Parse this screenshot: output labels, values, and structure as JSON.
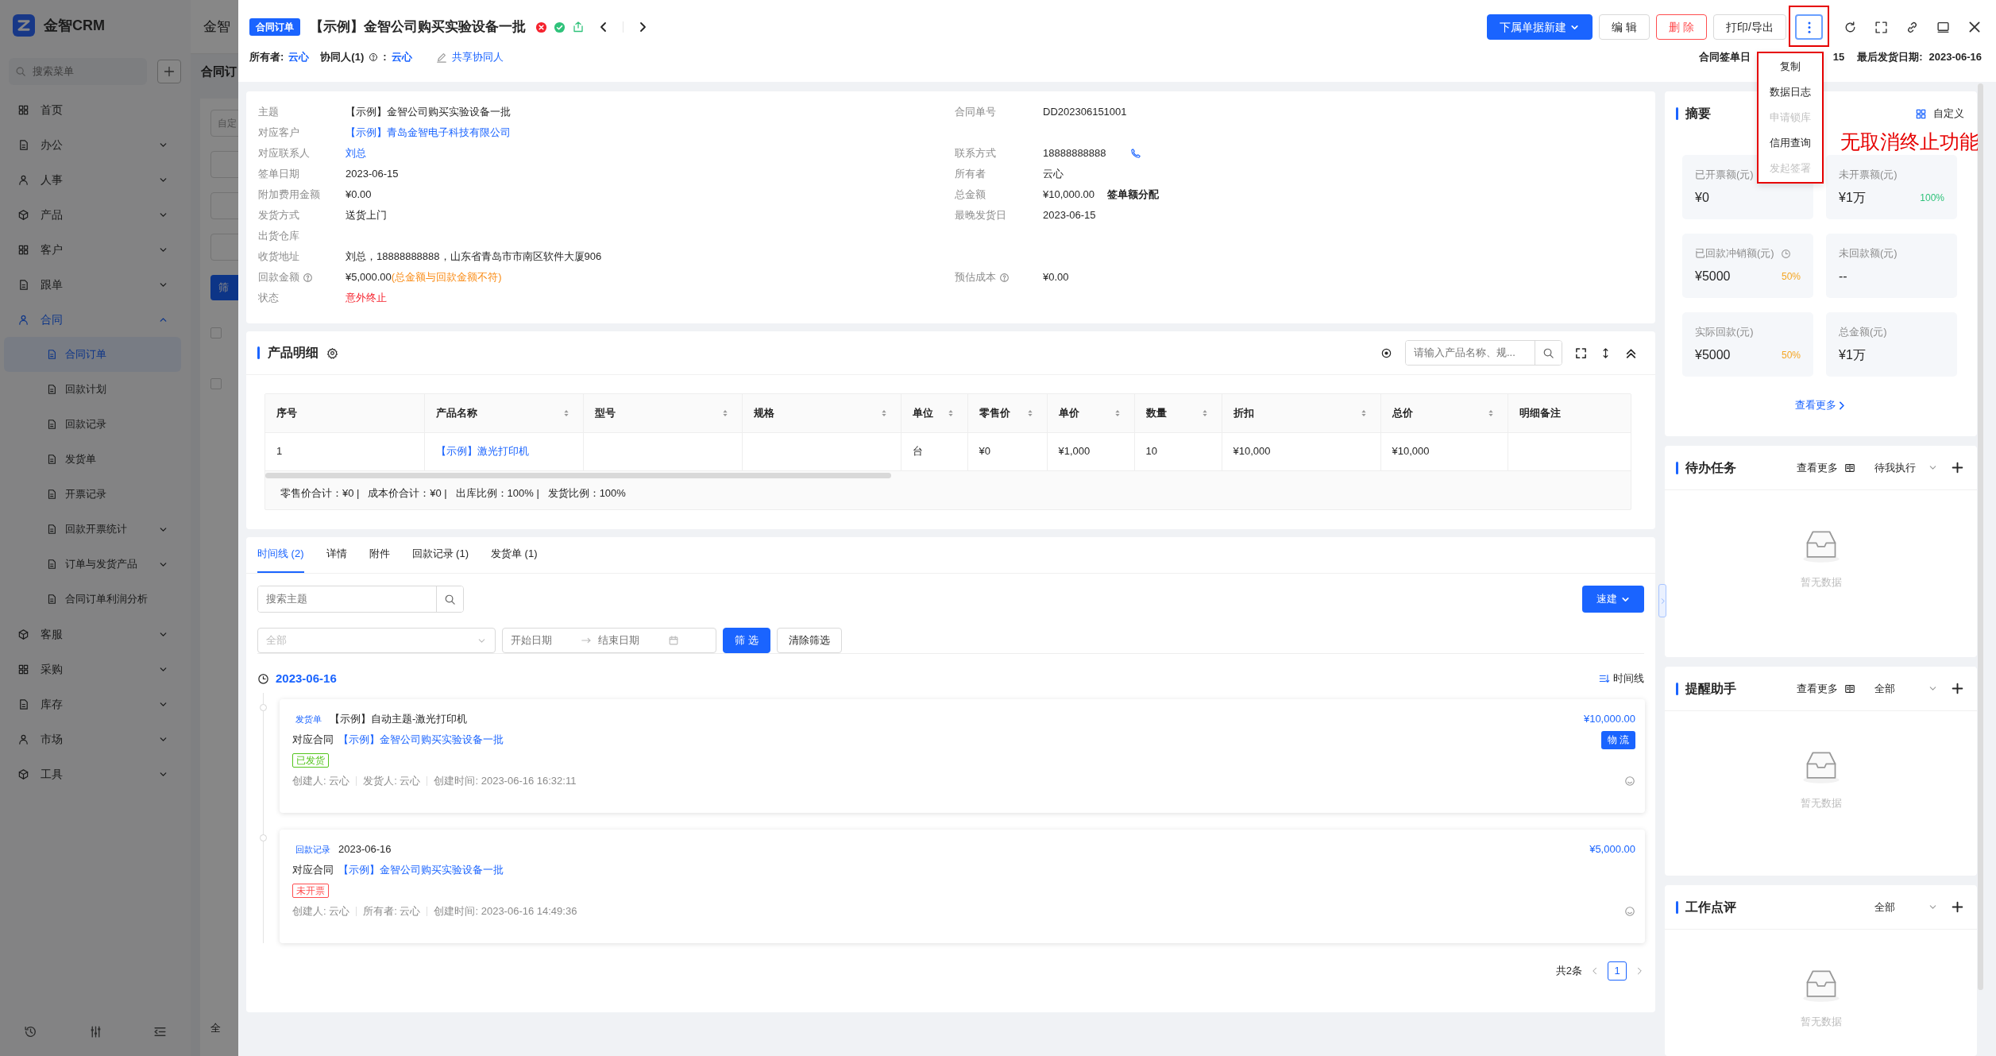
{
  "sidebar": {
    "brand": "金智CRM",
    "search_placeholder": "搜索菜单",
    "items": [
      {
        "label": "首页",
        "selected": false
      },
      {
        "label": "办公",
        "selected": false,
        "expanded": false
      },
      {
        "label": "人事",
        "selected": false,
        "expanded": false
      },
      {
        "label": "产品",
        "selected": false,
        "expanded": false
      },
      {
        "label": "客户",
        "selected": false,
        "expanded": false
      },
      {
        "label": "跟单",
        "selected": false,
        "expanded": false
      },
      {
        "label": "合同",
        "selected": true,
        "expanded": true,
        "children": [
          {
            "label": "合同订单",
            "selected": true
          },
          {
            "label": "回款计划",
            "selected": false
          },
          {
            "label": "回款记录",
            "selected": false
          },
          {
            "label": "发货单",
            "selected": false
          },
          {
            "label": "开票记录",
            "selected": false
          },
          {
            "label": "回款开票统计",
            "selected": false,
            "expanded": false
          },
          {
            "label": "订单与发货产品",
            "selected": false,
            "expanded": false
          },
          {
            "label": "合同订单利润分析",
            "selected": false
          }
        ]
      },
      {
        "label": "客服",
        "selected": false,
        "expanded": false
      },
      {
        "label": "采购",
        "selected": false,
        "expanded": false
      },
      {
        "label": "库存",
        "selected": false,
        "expanded": false
      },
      {
        "label": "市场",
        "selected": false,
        "expanded": false
      },
      {
        "label": "工具",
        "selected": false,
        "expanded": false
      }
    ]
  },
  "background": {
    "app_name_fragment": "金智",
    "page_title_fragment": "合同订",
    "field_fragment": "自定",
    "button_fragment": "筛",
    "checkboxes": [
      {
        "checked": false
      },
      {
        "checked": false
      }
    ],
    "footer_fragment": "全"
  },
  "header": {
    "type_tag": "合同订单",
    "title": "【示例】金智公司购买实验设备一批",
    "owner_label": "所有者:",
    "owner": "云心",
    "collaborator_label": "协同人(1)",
    "collaborator_colon": ":",
    "collaborator": "云心",
    "share": "共享协同人",
    "actions": [
      {
        "label": "下属单据新建",
        "kind": "primary-dropdown"
      },
      {
        "label": "编 辑",
        "kind": "default"
      },
      {
        "label": "删 除",
        "kind": "danger"
      },
      {
        "label": "打印/导出",
        "kind": "default"
      }
    ],
    "more_menu": {
      "open": true,
      "items": [
        {
          "label": "复制",
          "disabled": false
        },
        {
          "label": "数据日志",
          "disabled": false
        },
        {
          "label": "申请锁库",
          "disabled": true
        },
        {
          "label": "信用查询",
          "disabled": false
        },
        {
          "label": "发起签署",
          "disabled": true
        }
      ]
    },
    "annotation": "无取消终止功能",
    "sign_date_label": "合同签单日",
    "sign_date_value": "15",
    "last_ship_label": "最后发货日期:",
    "last_ship_value": "2023-06-16"
  },
  "details": [
    {
      "left": {
        "label": "主题",
        "value": "【示例】金智公司购买实验设备一批"
      },
      "right": {
        "label": "合同单号",
        "value": "DD202306151001"
      }
    },
    {
      "left": {
        "label": "对应客户",
        "value": "【示例】青岛金智电子科技有限公司",
        "kind": "link"
      }
    },
    {
      "left": {
        "label": "对应联系人",
        "value": "刘总",
        "kind": "link"
      },
      "right": {
        "label": "联系方式",
        "value": "18888888888",
        "kind": "phone"
      }
    },
    {
      "left": {
        "label": "签单日期",
        "value": "2023-06-15"
      },
      "right": {
        "label": "所有者",
        "value": "云心"
      }
    },
    {
      "left": {
        "label": "附加费用金额",
        "value": "¥0.00"
      },
      "right": {
        "label": "总金额",
        "value": "¥10,000.00",
        "action": "签单额分配"
      }
    },
    {
      "left": {
        "label": "发货方式",
        "value": "送货上门"
      },
      "right": {
        "label": "最晚发货日",
        "value": "2023-06-15"
      }
    },
    {
      "left": {
        "label": "出货仓库"
      }
    },
    {
      "left": {
        "label": "收货地址",
        "value": "刘总，18888888888，山东省青岛市市南区软件大厦906"
      }
    },
    {
      "left": {
        "label": "回款金额",
        "help": true,
        "value": "¥5,000.00",
        "note": "(总金额与回款金额不符)"
      },
      "right": {
        "label": "预估成本",
        "help": true,
        "value": "¥0.00"
      }
    },
    {
      "left": {
        "label": "状态",
        "value": "意外终止",
        "kind": "danger"
      }
    }
  ],
  "products": {
    "title": "产品明细",
    "search_placeholder": "请输入产品名称、规...",
    "columns": [
      {
        "label": "序号",
        "sortable": false
      },
      {
        "label": "产品名称",
        "sortable": true
      },
      {
        "label": "型号",
        "sortable": true
      },
      {
        "label": "规格",
        "sortable": true
      },
      {
        "label": "单位",
        "sortable": true
      },
      {
        "label": "零售价",
        "sortable": true
      },
      {
        "label": "单价",
        "sortable": true
      },
      {
        "label": "数量",
        "sortable": true
      },
      {
        "label": "折扣",
        "sortable": true
      },
      {
        "label": "总价",
        "sortable": true
      },
      {
        "label": "明细备注",
        "sortable": false
      }
    ],
    "rows": [
      {
        "cells": [
          {
            "text": "1"
          },
          {
            "text": "【示例】激光打印机",
            "kind": "link"
          },
          null,
          null,
          {
            "text": "台"
          },
          {
            "text": "¥0"
          },
          {
            "text": "¥1,000"
          },
          {
            "text": "10"
          },
          {
            "text": "¥10,000"
          },
          {
            "text": "¥10,000"
          },
          null
        ]
      }
    ],
    "summary": "零售价合计：¥0 |   成本价合计：¥0 |   出库比例：100% |   发货比例：100%"
  },
  "timeline": {
    "tabs": [
      {
        "label": "时间线 (2)",
        "selected": true
      },
      {
        "label": "详情",
        "selected": false
      },
      {
        "label": "附件",
        "selected": false
      },
      {
        "label": "回款记录 (1)",
        "selected": false
      },
      {
        "label": "发货单 (1)",
        "selected": false
      }
    ],
    "search_placeholder": "搜索主题",
    "quick_create": "速建",
    "type_placeholder": "全部",
    "start_placeholder": "开始日期",
    "end_placeholder": "结束日期",
    "filter_button": "筛 选",
    "clear_button": "清除筛选",
    "date": "2023-06-16",
    "view_toggle": "时间线",
    "entries": [
      {
        "tag": "发货单",
        "title": "【示例】自动主题-激光打印机",
        "amount": "¥10,000.00",
        "contract_label": "对应合同",
        "contract": "【示例】金智公司购买实验设备一批",
        "action": "物 流",
        "status": {
          "label": "已发货",
          "color": "#52c41a"
        },
        "meta": [
          "创建人: 云心",
          "发货人: 云心",
          "创建时间: 2023-06-16 16:32:11"
        ]
      },
      {
        "tag": "回款记录",
        "title": "2023-06-16",
        "amount": "¥5,000.00",
        "contract_label": "对应合同",
        "contract": "【示例】金智公司购买实验设备一批",
        "status": {
          "label": "未开票",
          "color": "#ff4d4f"
        },
        "meta": [
          "创建人: 云心",
          "所有者: 云心",
          "创建时间: 2023-06-16 14:49:36"
        ]
      }
    ],
    "total": "共2条",
    "pages": [
      {
        "label": "1",
        "selected": true
      }
    ]
  },
  "summary": {
    "title": "摘要",
    "customize": "自定义",
    "stats": [
      {
        "label": "已开票额(元)",
        "value": "¥0"
      },
      {
        "label": "未开票额(元)",
        "value": "¥1万",
        "percent": "100%",
        "color": "#2fc27a"
      },
      {
        "label": "已回款冲销额(元)",
        "value": "¥5000",
        "percent": "50%",
        "color": "#f5a623"
      },
      {
        "label": "未回款额(元)",
        "value": "--"
      },
      {
        "label": "实际回款(元)",
        "value": "¥5000",
        "percent": "50%",
        "color": "#f5a623"
      },
      {
        "label": "总金额(元)",
        "value": "¥1万"
      }
    ],
    "more": "查看更多"
  },
  "panels": [
    {
      "title": "待办任务",
      "more": "查看更多",
      "filter": "待我执行",
      "empty": "暂无数据"
    },
    {
      "title": "提醒助手",
      "more": "查看更多",
      "filter": "全部",
      "empty": "暂无数据"
    },
    {
      "title": "工作点评",
      "filter": "全部",
      "empty": "暂无数据"
    }
  ]
}
